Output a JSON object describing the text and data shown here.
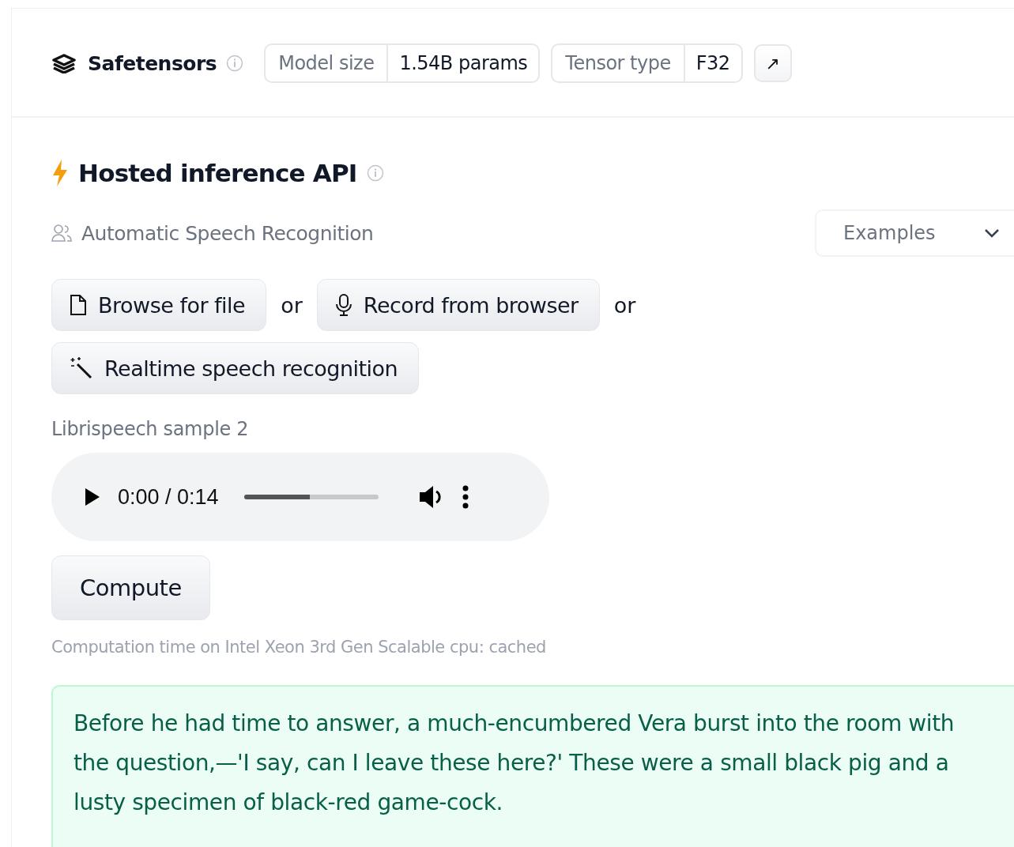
{
  "safetensors": {
    "title": "Safetensors",
    "tags": [
      {
        "label": "Model size",
        "value": "1.54B params"
      },
      {
        "label": "Tensor type",
        "value": "F32"
      }
    ],
    "link": "↗"
  },
  "inference": {
    "title": "Hosted inference API",
    "task": "Automatic Speech Recognition",
    "examples": {
      "placeholder": "Examples"
    },
    "inputs": [
      {
        "kind": "file",
        "label": "Browse for file"
      },
      {
        "kind": "separator",
        "label": "or"
      },
      {
        "kind": "mic",
        "label": "Record from browser"
      },
      {
        "kind": "separator",
        "label": "or"
      },
      {
        "kind": "wand",
        "label": "Realtime speech recognition"
      }
    ],
    "sample_label": "Librispeech sample 2",
    "player": {
      "time": "0:00 / 0:14",
      "level": 0.49
    },
    "compute": "Compute",
    "computation_time": "Computation time on Intel Xeon 3rd Gen Scalable cpu: cached",
    "output": "Before he had time to answer, a much-encumbered Vera burst into the room with the question,—'I say, can I leave these here?' These were a small black pig and a lusty specimen of black-red game-cock."
  }
}
